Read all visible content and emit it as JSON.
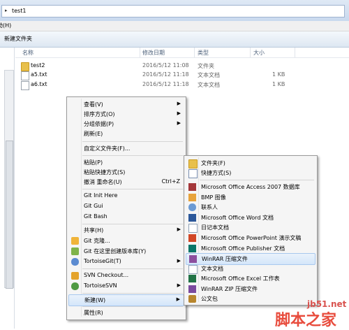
{
  "address_bar": {
    "crumb": "test1"
  },
  "menubar": {
    "item": "助(H)"
  },
  "toolbar": {
    "new_folder": "新建文件夹"
  },
  "columns": {
    "name": "名称",
    "date": "修改日期",
    "type": "类型",
    "size": "大小"
  },
  "files": [
    {
      "name": "test2",
      "date": "2016/5/12 11:08",
      "type": "文件夹",
      "size": ""
    },
    {
      "name": "a5.txt",
      "date": "2016/5/12 11:18",
      "type": "文本文档",
      "size": "1 KB"
    },
    {
      "name": "a6.txt",
      "date": "2016/5/12 11:18",
      "type": "文本文档",
      "size": "1 KB"
    }
  ],
  "context_menu": [
    {
      "label": "查看(V)",
      "submenu": true
    },
    {
      "label": "排序方式(O)",
      "submenu": true
    },
    {
      "label": "分组依据(P)",
      "submenu": true
    },
    {
      "label": "刷新(E)"
    },
    {
      "label": "自定义文件夹(F)..."
    },
    {
      "label": "粘贴(P)"
    },
    {
      "label": "粘贴快捷方式(S)"
    },
    {
      "label": "撤消 重命名(U)",
      "shortcut": "Ctrl+Z"
    },
    {
      "label": "Git Init Here"
    },
    {
      "label": "Git Gui"
    },
    {
      "label": "Git Bash"
    },
    {
      "label": "共享(H)",
      "submenu": true
    },
    {
      "label": "Git 克隆..."
    },
    {
      "label": "Git 在这里创建版本库(Y)"
    },
    {
      "label": "TortoiseGit(T)",
      "submenu": true
    },
    {
      "label": "SVN Checkout..."
    },
    {
      "label": "TortoiseSVN",
      "submenu": true
    },
    {
      "label": "新建(W)",
      "submenu": true
    },
    {
      "label": "属性(R)"
    }
  ],
  "new_submenu": [
    {
      "label": "文件夹(F)"
    },
    {
      "label": "快捷方式(S)"
    },
    {
      "label": "Microsoft Office Access 2007 数据库"
    },
    {
      "label": "BMP 图像"
    },
    {
      "label": "联系人"
    },
    {
      "label": "Microsoft Office Word 文档"
    },
    {
      "label": "日记本文档"
    },
    {
      "label": "Microsoft Office PowerPoint 演示文稿"
    },
    {
      "label": "Microsoft Office Publisher 文档"
    },
    {
      "label": "WinRAR 压缩文件"
    },
    {
      "label": "文本文档"
    },
    {
      "label": "Microsoft Office Excel 工作表"
    },
    {
      "label": "WinRAR ZIP 压缩文件"
    },
    {
      "label": "公文包"
    }
  ],
  "watermark": {
    "site": "jb51.net",
    "brand": "脚本之家"
  }
}
